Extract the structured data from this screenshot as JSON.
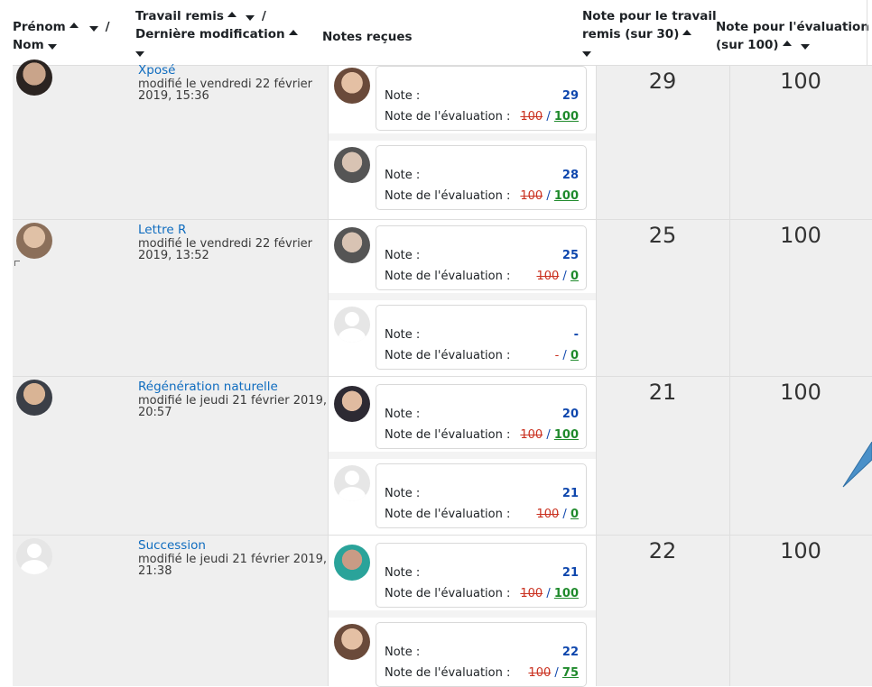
{
  "header": {
    "col_name_first": "Prénom",
    "col_name_last": "Nom",
    "slash": "/",
    "col_work_submitted": "Travail remis",
    "col_last_modified": "Dernière modification",
    "col_grades_received": "Notes reçues",
    "col_grade_work_line1": "Note pour le travail",
    "col_grade_work_line2": "remis (sur 30)",
    "col_grade_eval_line1": "Note pour l'évaluation",
    "col_grade_eval_line2": "(sur 100)"
  },
  "labels": {
    "note": "Note :",
    "eval": "Note de l'évaluation :"
  },
  "rows": [
    {
      "title": "Xposé",
      "modified": "modifié le vendredi 22 février 2019, 15:36",
      "grade_work": "29",
      "grade_eval": "100",
      "student_avatar": "avatar-photo",
      "reviews": [
        {
          "note": "29",
          "eval_old": "100",
          "slash": " / ",
          "eval_new": "100",
          "avatar": "photo"
        },
        {
          "note": "28",
          "eval_old": "100",
          "slash": " / ",
          "eval_new": "100",
          "avatar": "photo"
        }
      ]
    },
    {
      "title": "Lettre R",
      "modified": "modifié le vendredi 22 février 2019, 13:52",
      "grade_work": "25",
      "grade_eval": "100",
      "student_avatar": "avatar-photo",
      "reviews": [
        {
          "note": "25",
          "eval_old": "100",
          "slash": " / ",
          "eval_new": "0",
          "avatar": "photo"
        },
        {
          "note": "-",
          "eval_old": "-",
          "slash": " / ",
          "eval_new": "0",
          "avatar": "blank"
        }
      ]
    },
    {
      "title": "Régénération naturelle",
      "modified": "modifié le jeudi 21 février 2019, 20:57",
      "grade_work": "21",
      "grade_eval": "100",
      "student_avatar": "avatar-photo",
      "reviews": [
        {
          "note": "20",
          "eval_old": "100",
          "slash": " / ",
          "eval_new": "100",
          "avatar": "photo"
        },
        {
          "note": "21",
          "eval_old": "100",
          "slash": " / ",
          "eval_new": "0",
          "avatar": "blank"
        }
      ]
    },
    {
      "title": "Succession",
      "modified": "modifié le jeudi 21 février 2019, 21:38",
      "grade_work": "22",
      "grade_eval": "100",
      "student_avatar": "avatar-blank",
      "reviews": [
        {
          "note": "21",
          "eval_old": "100",
          "slash": " / ",
          "eval_new": "100",
          "avatar": "photo"
        },
        {
          "note": "22",
          "eval_old": "100",
          "slash": " / ",
          "eval_new": "75",
          "avatar": "photo"
        }
      ]
    }
  ],
  "colors": {
    "link": "#0f6cbf",
    "grade_blue": "#0f47ad",
    "strike_red": "#ca3120",
    "new_green": "#1f8a2c",
    "row_gray": "#efefef"
  }
}
